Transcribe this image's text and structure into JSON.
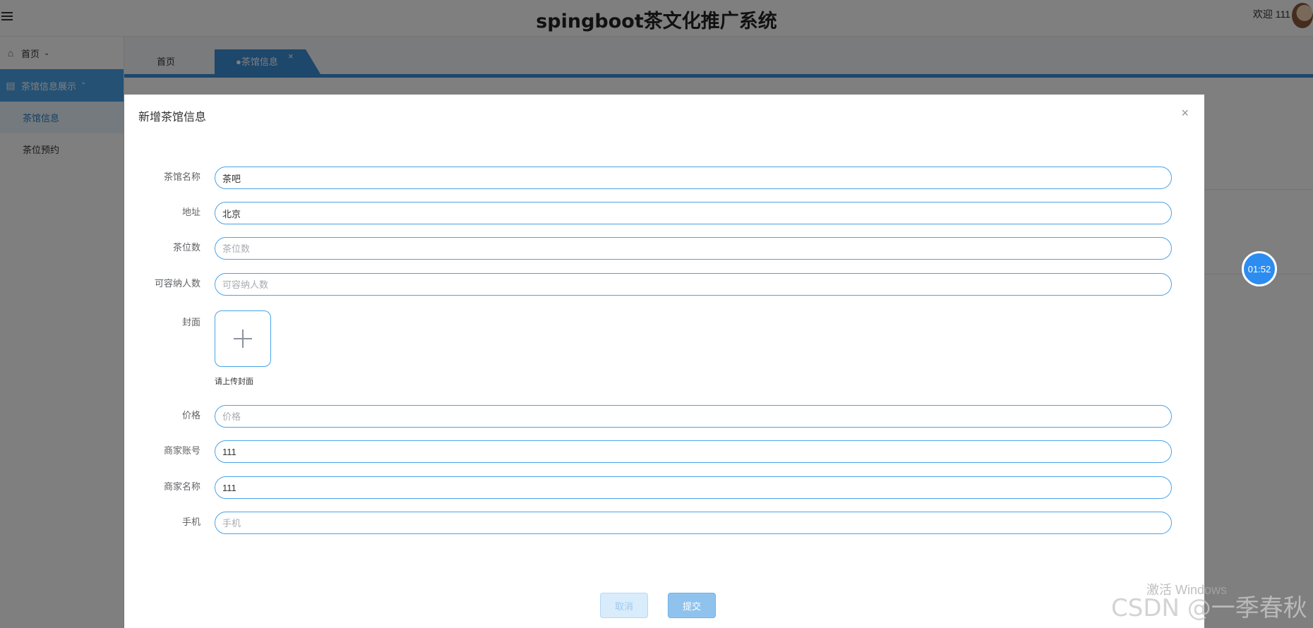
{
  "app": {
    "title": "spingboot茶文化推广系统",
    "welcome": "欢迎 111"
  },
  "sidebar": {
    "home": "首页",
    "group": "茶馆信息展示",
    "items": [
      {
        "label": "茶馆信息"
      },
      {
        "label": "茶位预约"
      }
    ]
  },
  "tabs": {
    "home": "首页",
    "current": "●茶馆信息",
    "close": "×"
  },
  "dialog": {
    "title": "新增茶馆信息",
    "close": "×",
    "fields": {
      "name": {
        "label": "茶馆名称",
        "value": "茶吧",
        "placeholder": "茶馆名称"
      },
      "address": {
        "label": "地址",
        "value": "北京",
        "placeholder": "地址"
      },
      "seats": {
        "label": "茶位数",
        "value": "",
        "placeholder": "茶位数"
      },
      "capacity": {
        "label": "可容纳人数",
        "value": "",
        "placeholder": "可容纳人数"
      },
      "cover": {
        "label": "封面",
        "tip": "请上传封面"
      },
      "price": {
        "label": "价格",
        "value": "",
        "placeholder": "价格"
      },
      "merchant_account": {
        "label": "商家账号",
        "value": "111",
        "placeholder": "商家账号"
      },
      "merchant_name": {
        "label": "商家名称",
        "value": "111",
        "placeholder": "商家名称"
      },
      "phone": {
        "label": "手机",
        "value": "",
        "placeholder": "手机"
      }
    },
    "buttons": {
      "cancel": "取消",
      "submit": "提交"
    }
  },
  "timer": "01:52",
  "watermarks": {
    "windows": "激活 Windows",
    "csdn": "CSDN @一季春秋"
  },
  "colors": {
    "accent": "#3a8ed6",
    "input_border": "#4aa3e8",
    "timer": "#2d8cf0"
  }
}
